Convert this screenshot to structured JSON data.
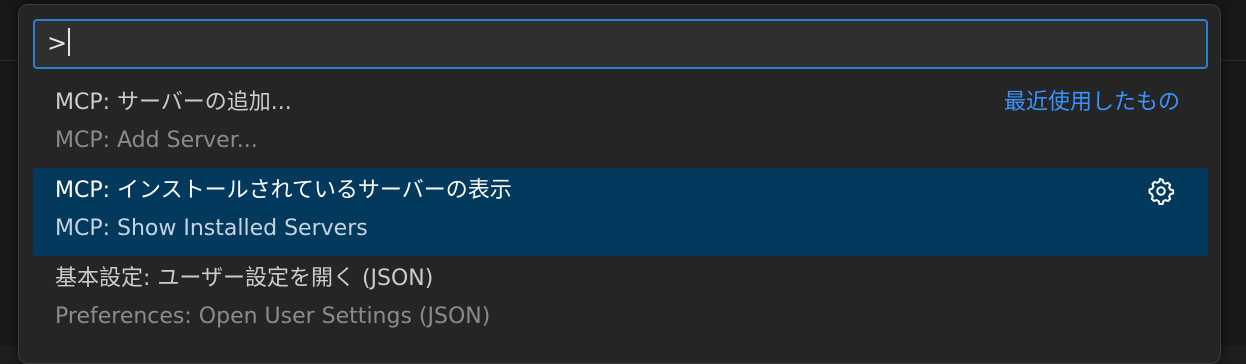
{
  "input": {
    "value": ">"
  },
  "items": [
    {
      "primary": "MCP: サーバーの追加...",
      "secondary": "MCP: Add Server...",
      "badge": "最近使用したもの"
    },
    {
      "primary": "MCP: インストールされているサーバーの表示",
      "secondary": "MCP: Show Installed Servers",
      "action_icon": "gear-icon"
    },
    {
      "primary": "基本設定: ユーザー設定を開く (JSON)",
      "secondary": "Preferences: Open User Settings (JSON)"
    }
  ],
  "colors": {
    "accent": "#2f7dd1",
    "selection": "#04395e",
    "recent_label": "#3794ff"
  }
}
